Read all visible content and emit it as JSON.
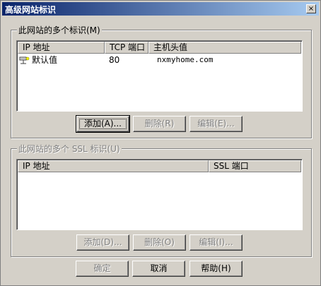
{
  "window": {
    "title": "高级网站标识",
    "close_icon": "×"
  },
  "group1": {
    "label": "此网站的多个标识(M)",
    "columns": [
      "IP 地址",
      "TCP 端口",
      "主机头值"
    ],
    "rows": [
      {
        "ip": "默认值",
        "port": "80",
        "host": "nxmyhome.com"
      }
    ],
    "buttons": {
      "add": "添加(A)...",
      "remove": "删除(R)",
      "edit": "编辑(E)..."
    }
  },
  "group2": {
    "label": "此网站的多个 SSL 标识(U)",
    "columns": [
      "IP 地址",
      "SSL 端口"
    ],
    "buttons": {
      "add": "添加(D)...",
      "remove": "删除(O)",
      "edit": "编辑(I)..."
    }
  },
  "footer": {
    "ok": "确定",
    "cancel": "取消",
    "help": "帮助(H)"
  }
}
